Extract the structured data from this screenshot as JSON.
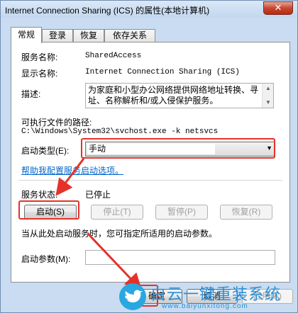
{
  "window": {
    "title": "Internet Connection Sharing (ICS) 的属性(本地计算机)",
    "close_glyph": "✕"
  },
  "tabs": [
    {
      "label": "常规",
      "active": true
    },
    {
      "label": "登录",
      "active": false
    },
    {
      "label": "恢复",
      "active": false
    },
    {
      "label": "依存关系",
      "active": false
    }
  ],
  "general": {
    "service_name_label": "服务名称:",
    "service_name_value": "SharedAccess",
    "display_name_label": "显示名称:",
    "display_name_value": "Internet Connection Sharing (ICS)",
    "description_label": "描述:",
    "description_value": "为家庭和小型办公网络提供网络地址转换、寻址、名称解析和/或入侵保护服务。",
    "exe_path_label": "可执行文件的路径:",
    "exe_path_value": "C:\\Windows\\System32\\svchost.exe -k netsvcs",
    "startup_type_label": "启动类型(E):",
    "startup_type_value": "手动",
    "help_link": "帮助我配置服务启动选项。",
    "status_label": "服务状态:",
    "status_value": "已停止",
    "start_params_hint": "当从此处启动服务时，您可指定所适用的启动参数。",
    "start_params_label": "启动参数(M):",
    "start_params_value": ""
  },
  "service_buttons": {
    "start": "启动(S)",
    "stop": "停止(T)",
    "pause": "暂停(P)",
    "resume": "恢复(R)"
  },
  "dialog_buttons": {
    "ok": "确定",
    "cancel": "取消",
    "apply": "应用(A)"
  },
  "icons": {
    "dropdown": "chevron-down-icon",
    "scroll_up": "scroll-up-icon",
    "scroll_down": "scroll-down-icon"
  },
  "watermark": {
    "title": "白云一键重装系统",
    "url": "www.baiyunxitong.com"
  },
  "colors": {
    "highlight_red": "#e4322b",
    "link_blue": "#0066cc",
    "watermark_blue": "#2a8fd6"
  }
}
